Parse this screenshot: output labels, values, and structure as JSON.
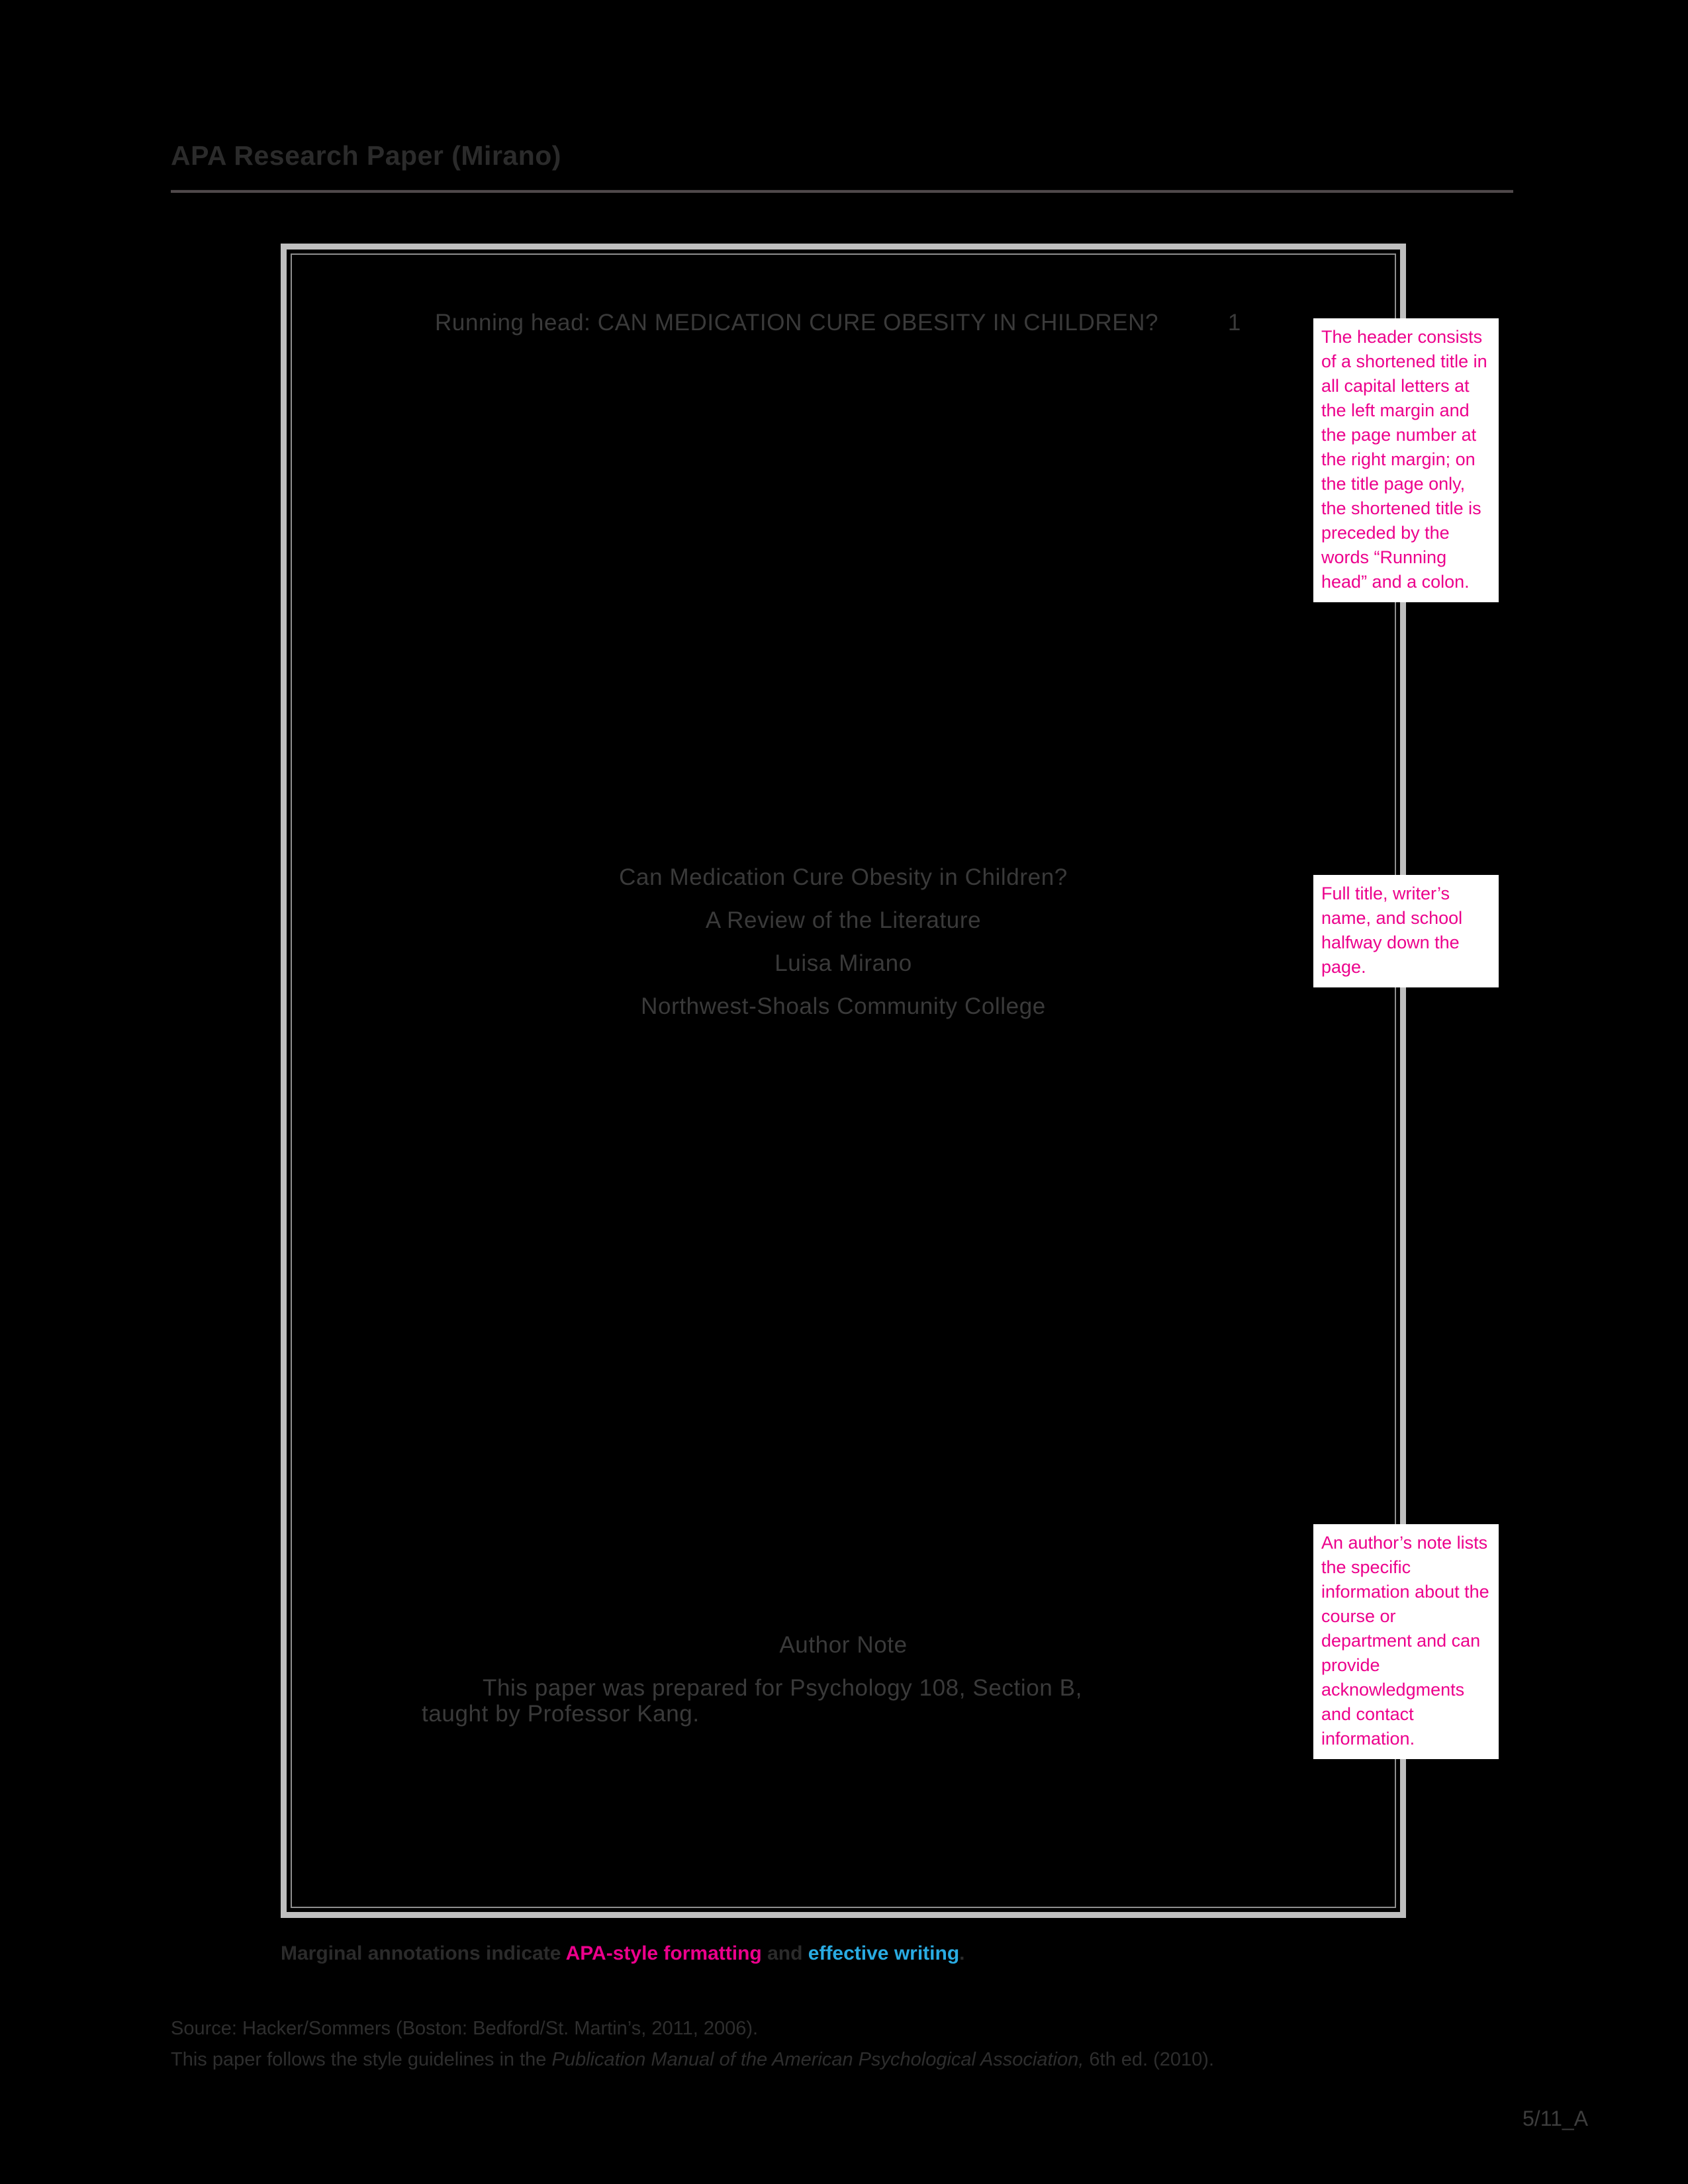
{
  "handout": {
    "title": "APA Research Paper (Mirano)",
    "legend": {
      "prefix": "Marginal annotations indicate ",
      "apa_part": "APA-style formatting",
      "middle": " and ",
      "writing_part": "effective writing",
      "suffix": "."
    },
    "source_line_1": "Source: Hacker/Sommers (Boston: Bedford/St. Martin’s, 2011, 2006).",
    "source_line_2_prefix": "This paper follows the style guidelines in the ",
    "source_line_2_italic": "Publication Manual of the American Psychological Association,",
    "source_line_2_suffix": " 6th ed. (2010).",
    "page_code": "5/11_A"
  },
  "manuscript": {
    "running_head": "Running head: CAN MEDICATION CURE OBESITY IN CHILDREN?",
    "page_number": "1",
    "title_line_1": "Can Medication Cure Obesity in Children?",
    "title_line_2": "A Review of the Literature",
    "author": "Luisa Mirano",
    "school": "Northwest-Shoals Community College",
    "author_note_heading": "Author Note",
    "author_note_body": "This paper was prepared for Psychology 108, Section B, taught by Professor Kang."
  },
  "annotations": {
    "header_note": "The header consists of a shortened title in all capital letters at the left margin and the page number at the right margin; on the title page only, the shortened title is preceded by the words “Running head” and a colon.",
    "title_note": "Full title, writer’s name, and school halfway down the page.",
    "author_note": "An author’s note lists the specific information about the course or department and can provide acknowledgments and contact information."
  },
  "colors": {
    "annotation_pink": "#ec008c",
    "writing_cyan": "#29abe2",
    "page_frame_gray": "#bfbfbf",
    "background": "#000000"
  }
}
